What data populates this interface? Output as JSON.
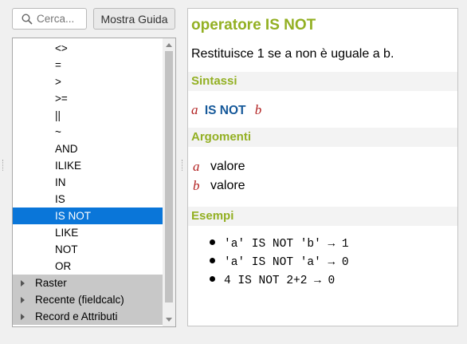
{
  "search": {
    "placeholder": "Cerca..."
  },
  "toolbar": {
    "show_help_label": "Mostra Guida"
  },
  "tree": {
    "items": [
      {
        "label": "<>"
      },
      {
        "label": "="
      },
      {
        "label": ">"
      },
      {
        "label": ">="
      },
      {
        "label": "||"
      },
      {
        "label": "~"
      },
      {
        "label": "AND"
      },
      {
        "label": "ILIKE"
      },
      {
        "label": "IN"
      },
      {
        "label": "IS"
      },
      {
        "label": "IS NOT",
        "selected": true
      },
      {
        "label": "LIKE"
      },
      {
        "label": "NOT"
      },
      {
        "label": "OR"
      }
    ],
    "groups": [
      {
        "label": "Raster"
      },
      {
        "label": "Recente (fieldcalc)"
      },
      {
        "label": "Record e Attributi"
      }
    ]
  },
  "help": {
    "title": "operatore IS NOT",
    "description": "Restituisce 1 se a non è uguale a b.",
    "syntax_heading": "Sintassi",
    "syntax": {
      "arg1": "a",
      "operator": "IS NOT",
      "arg2": "b"
    },
    "arguments_heading": "Argomenti",
    "arguments": [
      {
        "name": "a",
        "desc": "valore"
      },
      {
        "name": "b",
        "desc": "valore"
      }
    ],
    "examples_heading": "Esempi",
    "examples": [
      "'a' IS NOT 'b' → 1",
      "'a' IS NOT 'a' → 0",
      "4 IS NOT 2+2 → 0"
    ]
  },
  "colors": {
    "selection": "#0a76d9",
    "heading": "#93b023",
    "keyword": "#16599a",
    "argument": "#b22222"
  }
}
